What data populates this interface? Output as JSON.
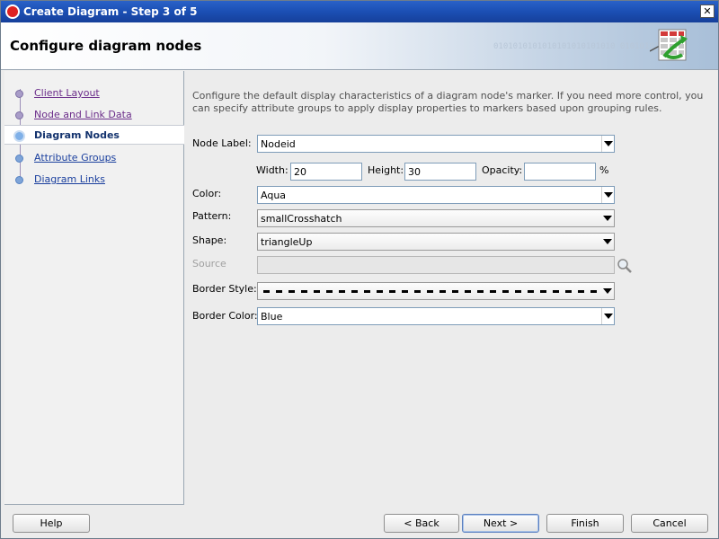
{
  "window": {
    "title": "Create Diagram - Step 3 of 5",
    "close": "✕"
  },
  "header": {
    "title": "Configure diagram nodes",
    "binary_text": "0101010101010101010101010 01010101010"
  },
  "nav": {
    "items": [
      {
        "label": "Client Layout",
        "state": "done"
      },
      {
        "label": "Node and Link Data",
        "state": "done"
      },
      {
        "label": "Diagram Nodes",
        "state": "current"
      },
      {
        "label": "Attribute Groups",
        "state": "todo"
      },
      {
        "label": "Diagram Links",
        "state": "todo"
      }
    ]
  },
  "content": {
    "description": "Configure the default display characteristics of a diagram node's marker. If you need more control, you can specify attribute groups to apply display properties to markers based upon grouping rules.",
    "node_label": {
      "label": "Node Label:",
      "value": "Nodeid"
    },
    "width": {
      "label": "Width:",
      "value": "20"
    },
    "height": {
      "label": "Height:",
      "value": "30"
    },
    "opacity": {
      "label": "Opacity:",
      "value": "",
      "unit": "%"
    },
    "color": {
      "label": "Color:",
      "value": "Aqua"
    },
    "pattern": {
      "label": "Pattern:",
      "value": "smallCrosshatch"
    },
    "shape": {
      "label": "Shape:",
      "value": "triangleUp"
    },
    "source": {
      "label": "Source",
      "value": ""
    },
    "border_style": {
      "label": "Border Style:",
      "value": "dashed"
    },
    "border_color": {
      "label": "Border Color:",
      "value": "Blue"
    }
  },
  "buttons": {
    "help": "Help",
    "back": "< Back",
    "next": "Next >",
    "finish": "Finish",
    "cancel": "Cancel"
  },
  "colors": {
    "titlebar": "#1b4fb4",
    "link_visited": "#6b2d8a",
    "link": "#1a3f9e"
  }
}
